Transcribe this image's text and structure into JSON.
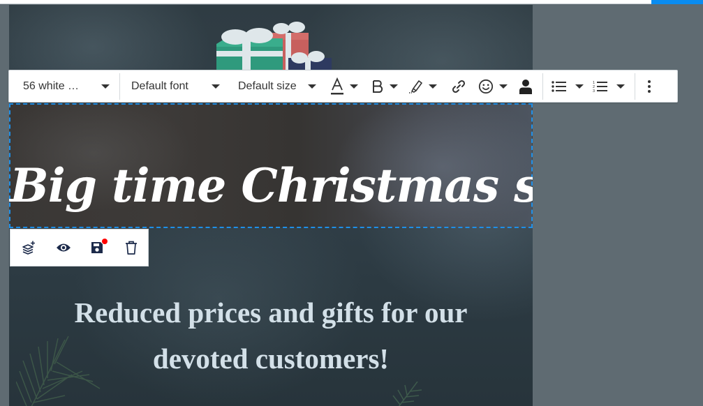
{
  "topbar": {
    "accent_color": "#0a8cf0"
  },
  "toolbar": {
    "style_select": {
      "value": "56 white …"
    },
    "font_select": {
      "value": "Default font"
    },
    "size_select": {
      "value": "Default size"
    },
    "buttons": [
      {
        "name": "text-color",
        "icon": "text-color-icon",
        "has_dropdown": true
      },
      {
        "name": "bold",
        "icon": "bold-icon",
        "has_dropdown": true
      },
      {
        "name": "highlight",
        "icon": "highlighter-icon",
        "has_dropdown": true
      },
      {
        "name": "link",
        "icon": "link-icon",
        "has_dropdown": false
      },
      {
        "name": "emoji",
        "icon": "emoji-icon",
        "has_dropdown": true
      },
      {
        "name": "personalize",
        "icon": "person-icon",
        "has_dropdown": false
      },
      {
        "name": "bulleted-list",
        "icon": "bulleted-list-icon",
        "has_dropdown": true
      },
      {
        "name": "numbered-list",
        "icon": "numbered-list-icon",
        "has_dropdown": true
      },
      {
        "name": "more",
        "icon": "more-vertical-icon",
        "has_dropdown": false
      }
    ]
  },
  "canvas": {
    "headline": "Big time Christmas sale",
    "subtext": "Reduced prices and gifts for our devoted customers!",
    "selection_color": "#1e8fe8"
  },
  "block_actions": {
    "buttons": [
      {
        "name": "add-layer",
        "icon": "layers-plus-icon"
      },
      {
        "name": "preview",
        "icon": "eye-icon"
      },
      {
        "name": "save",
        "icon": "save-icon",
        "badge": "unsaved",
        "badge_color": "#ff0000"
      },
      {
        "name": "delete",
        "icon": "trash-icon"
      }
    ]
  }
}
